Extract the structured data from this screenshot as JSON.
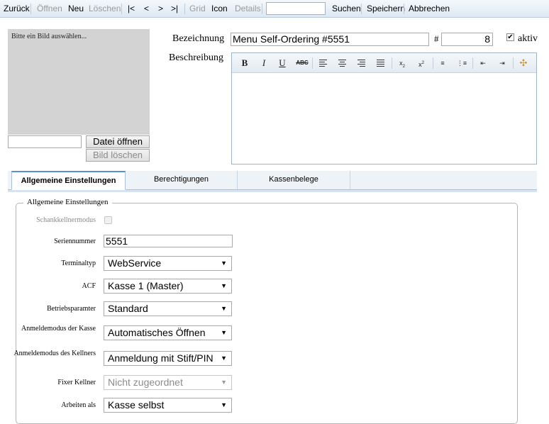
{
  "toolbar": {
    "back": "Zurück",
    "open": "Öffnen",
    "new": "Neu",
    "delete": "Löschen",
    "first": "|<",
    "prev": "<",
    "next": ">",
    "last": ">|",
    "grid": "Grid",
    "icon": "Icon",
    "details": "Details",
    "search_value": "",
    "search": "Suchen",
    "save": "Speichern",
    "cancel": "Abbrechen"
  },
  "image": {
    "placeholder": "Bitte ein Bild auswählen...",
    "file_value": "",
    "open_button": "Datei öffnen",
    "delete_button": "Bild löschen"
  },
  "header": {
    "name_label": "Bezeichnung",
    "name_value": "Menu Self-Ordering #5551",
    "number_label": "#",
    "number_value": "8",
    "active_label": "aktiv",
    "active_checked": true,
    "description_label": "Beschreibung"
  },
  "editor_tools": [
    "bold",
    "italic",
    "underline",
    "strikethrough",
    "align-left",
    "align-center",
    "align-right",
    "justify",
    "subscript",
    "superscript",
    "ordered-list",
    "unordered-list",
    "outdent",
    "indent",
    "clear-format"
  ],
  "tabs": [
    {
      "label": "Allgemeine Einstellungen",
      "active": true
    },
    {
      "label": "Berechtigungen",
      "active": false
    },
    {
      "label": "Kassenbelege",
      "active": false
    }
  ],
  "general": {
    "legend": "Allgemeine Einstellungen",
    "waiter_mode_label": "Schankkellnermodus",
    "serial_label": "Seriennummer",
    "serial_value": "5551",
    "terminal_label": "Terminaltyp",
    "terminal_value": "WebService",
    "acf_label": "ACF",
    "acf_value": "Kasse 1 (Master)",
    "params_label": "Betriebsparamter",
    "params_value": "Standard",
    "login_register_label": "Anmeldemodus der Kasse",
    "login_register_value": "Automatisches Öffnen",
    "login_waiter_label": "Anmeldemodus des Kellners",
    "login_waiter_value": "Anmeldung mit Stift/PIN",
    "fixed_waiter_label": "Fixer Kellner",
    "fixed_waiter_value": "Nicht zugeordnet",
    "work_as_label": "Arbeiten als",
    "work_as_value": "Kasse selbst"
  }
}
